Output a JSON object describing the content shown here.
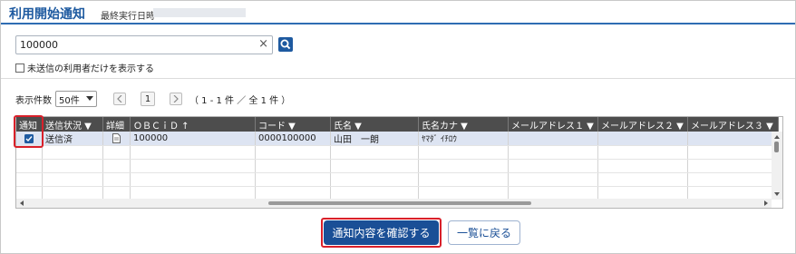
{
  "header": {
    "title": "利用開始通知",
    "last_run_label": "最終実行日時"
  },
  "search": {
    "value": "100000",
    "clear_icon": "×"
  },
  "filter": {
    "unsent_only_label": "未送信の利用者だけを表示する"
  },
  "pager": {
    "per_page_label": "表示件数",
    "per_page_value": "50件",
    "page": "1",
    "range_text": "（ 1 - 1 件 ／ 全 1 件 ）"
  },
  "table": {
    "columns": [
      "通知",
      "送信状況 ▼",
      "詳細",
      "ＯＢＣｉＤ ↑",
      "コード ▼",
      "氏名 ▼",
      "氏名カナ ▼",
      "メールアドレス１ ▼",
      "メールアドレス２ ▼",
      "メールアドレス３ ▼"
    ],
    "row": {
      "status": "送信済",
      "obcid": "100000",
      "code": "0000100000",
      "name": "山田　一朗",
      "kana": "ﾔﾏﾀﾞ ｲﾁﾛｳ"
    }
  },
  "actions": {
    "confirm_label": "通知内容を確認する",
    "back_label": "一覧に戻る"
  },
  "colors": {
    "accent": "#1e5aa0",
    "highlight": "#d9202a",
    "header_bg": "#4d4d4d",
    "selected_row": "#dde4f2"
  }
}
